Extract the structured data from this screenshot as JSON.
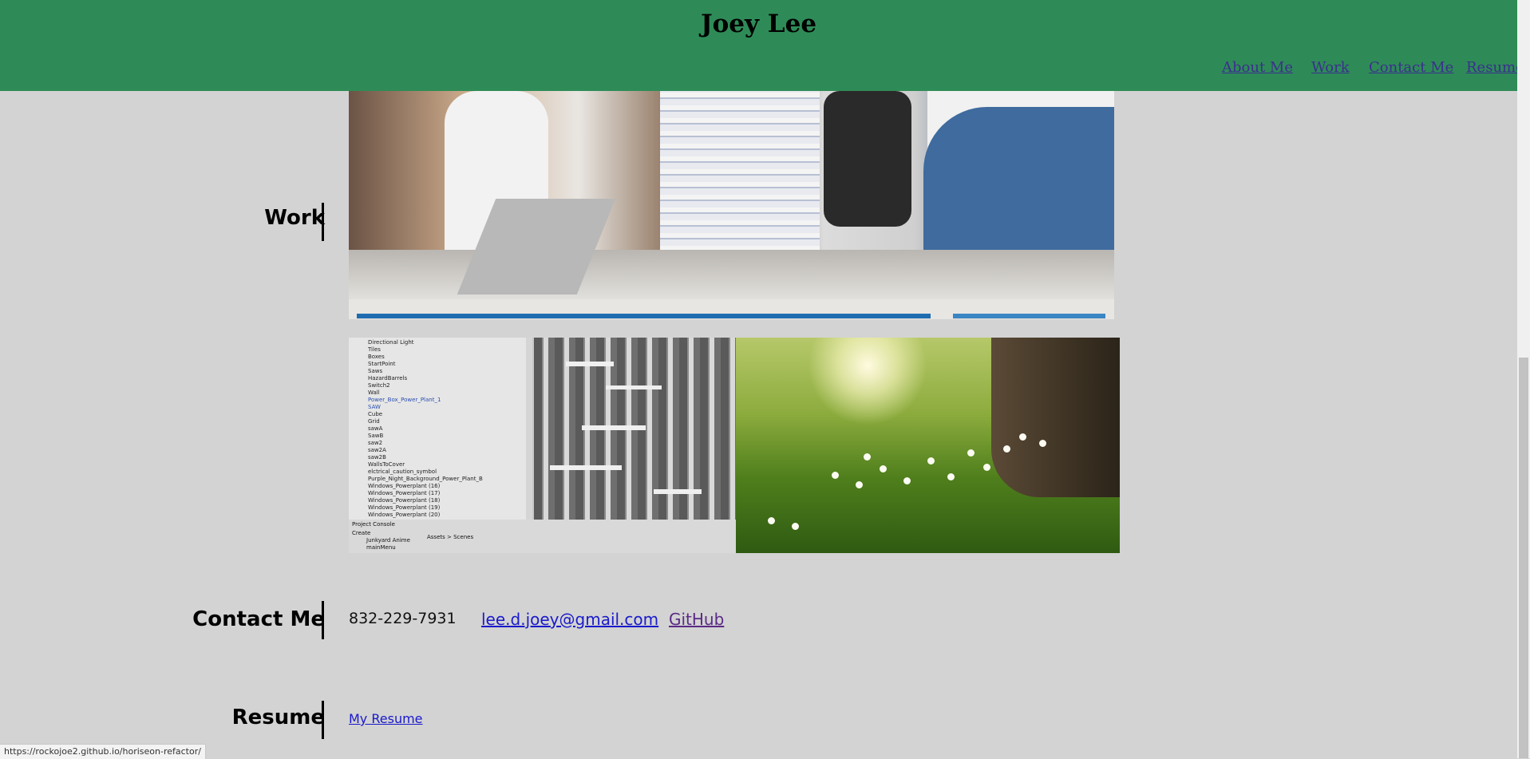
{
  "header": {
    "title": "Joey Lee",
    "nav": [
      "About Me",
      "Work",
      "Contact Me",
      "Resume"
    ],
    "background_color": "#2e8b57"
  },
  "work": {
    "label": "Work"
  },
  "editor_thumbnail": {
    "hierarchy_items": [
      "Directional Light",
      "Tiles",
      "Boxes",
      "StartPoint",
      "Saws",
      "HazardBarrels",
      "Switch2",
      "Wall",
      "Power_Box_Power_Plant_1",
      "SAW",
      "Cube",
      "Grid",
      "sawA",
      "SawB",
      "saw2",
      "saw2A",
      "saw2B",
      "WallsToCover",
      "elctrical_caution_symbol",
      "Purple_Night_Background_Power_Plant_B",
      "Windows_Powerplant (16)",
      "Windows_Powerplant (17)",
      "Windows_Powerplant (18)",
      "Windows_Powerplant (19)",
      "Windows_Powerplant (20)"
    ],
    "bottom_tabs": "Project  Console",
    "assets_path": "Assets > Scenes",
    "create_label": "Create",
    "asset_items": [
      "Junkyard Anime",
      "mainMenu"
    ]
  },
  "contact": {
    "label": "Contact Me",
    "phone": "832-229-7931",
    "email": "lee.d.joey@gmail.com",
    "github": "GitHub"
  },
  "resume": {
    "label": "Resume",
    "link": "My Resume"
  },
  "status_bar": {
    "url": "https://rockojoe2.github.io/horiseon-refactor/"
  }
}
